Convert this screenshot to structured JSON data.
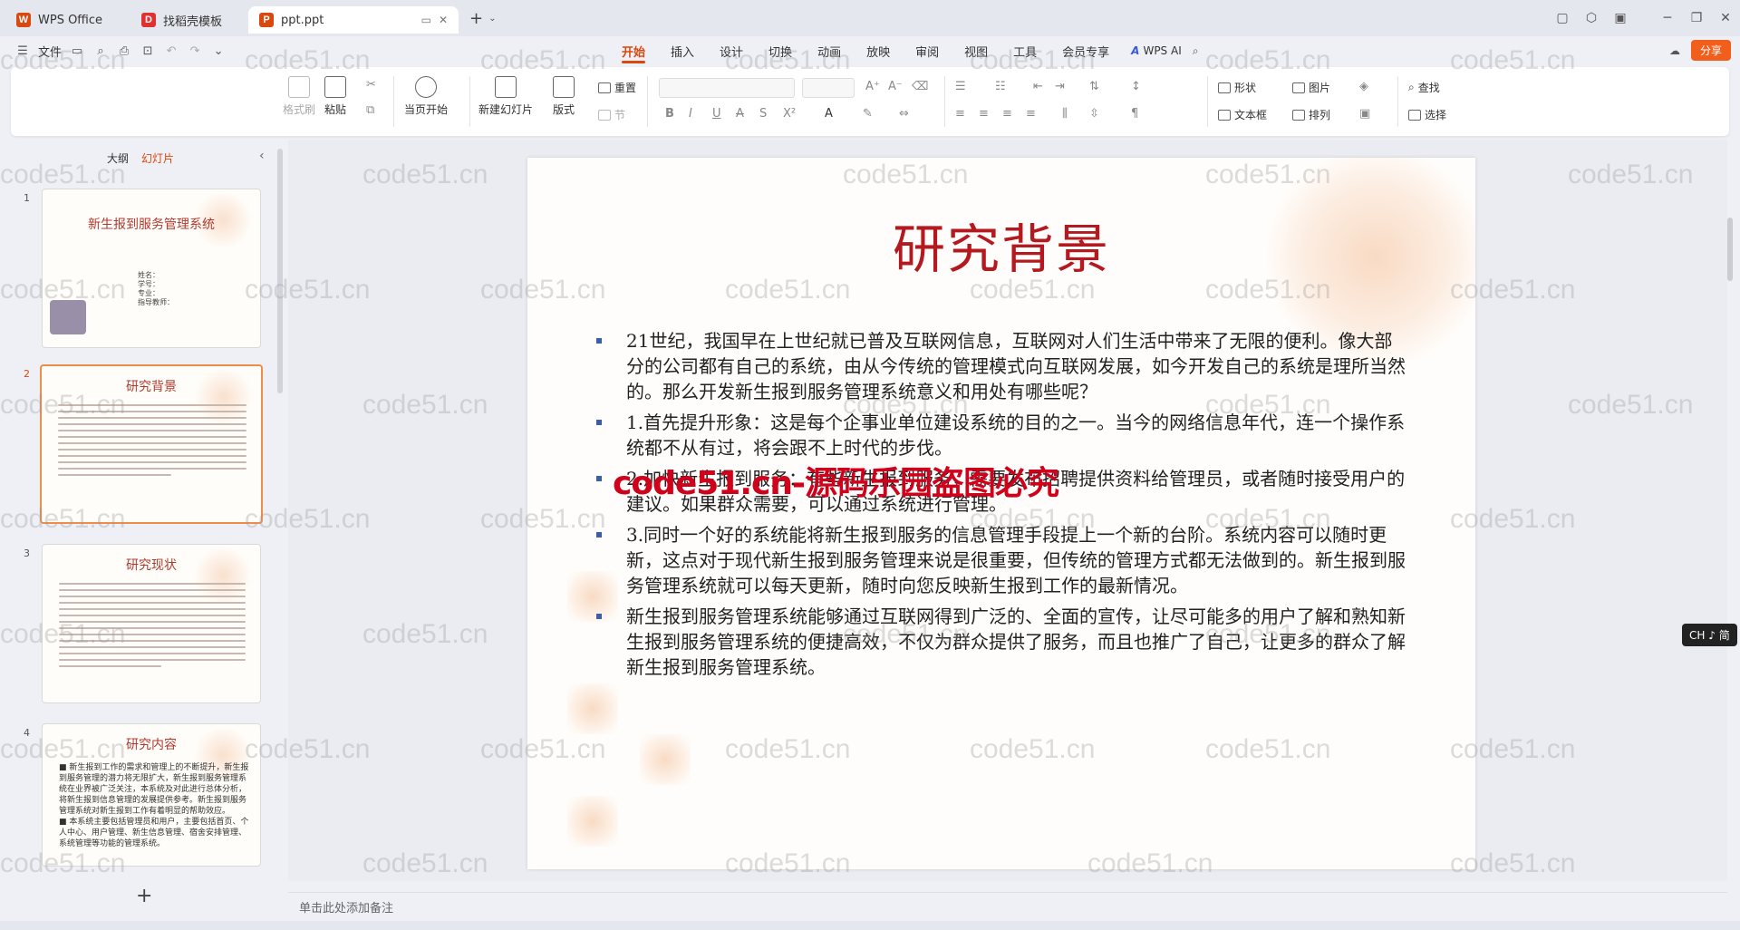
{
  "titlebar": {
    "tabs": [
      {
        "label": "WPS Office",
        "icon": "wps-logo-icon",
        "color": "#d9480f"
      },
      {
        "label": "找稻壳模板",
        "icon": "docer-icon",
        "color": "#e03131"
      },
      {
        "label": "ppt.ppt",
        "icon": "ppt-file-icon",
        "color": "#d9480f"
      }
    ],
    "new_tab": "+"
  },
  "menubar": {
    "file_label": "文件",
    "tabs": [
      "开始",
      "插入",
      "设计",
      "切换",
      "动画",
      "放映",
      "审阅",
      "视图",
      "工具",
      "会员专享"
    ],
    "active_tab": "开始",
    "ai_label": "WPS AI",
    "share_label": "分享"
  },
  "ribbon": {
    "format_painter": "格式刷",
    "paste": "粘贴",
    "play_from_current": "当页开始",
    "new_slide": "新建幻灯片",
    "layout": "版式",
    "reset": "重置",
    "section": "节",
    "shape": "形状",
    "picture": "图片",
    "textbox": "文本框",
    "arrange": "排列",
    "find": "查找",
    "select": "选择"
  },
  "left_panel": {
    "tabs": [
      "大纲",
      "幻灯片"
    ],
    "active_tab": "幻灯片",
    "slides": [
      {
        "num": "1",
        "title": "新生报到服务管理系统",
        "info": [
          "姓名：",
          "学号：",
          "专业：",
          "指导教师："
        ]
      },
      {
        "num": "2",
        "title": "研究背景"
      },
      {
        "num": "3",
        "title": "研究现状"
      },
      {
        "num": "4",
        "title": "研究内容",
        "text": "■ 新生报到工作的需求和管理上的不断提升，新生报到服务管理的潜力将无限扩大，新生报到服务管理系统在业界被广泛关注，本系统及对此进行总体分析，将新生报到信息管理的发展提供参考。新生报到服务管理系统对新生报到工作有着明显的帮助效应。\n■ 本系统主要包括管理员和用户，主要包括首页、个人中心、用户管理、新生信息管理、宿舍安排管理、系统管理等功能的管理系统。"
      }
    ],
    "add_slide": "+"
  },
  "slide": {
    "title": "研究背景",
    "bullets": [
      "21世纪，我国早在上世纪就已普及互联网信息，互联网对人们生活中带来了无限的便利。像大部分的公司都有自己的系统，由从今传统的管理模式向互联网发展，如今开发自己的系统是理所当然的。那么开发新生报到服务管理系统意义和用处有哪些呢？",
      "1.首先提升形象：这是每个企事业单位建设系统的目的之一。当今的网络信息年代，连一个操作系统都不从有过，将会跟不上时代的步伐。",
      "2.加快新生报到服务：有些新生报到服务，需要发布招聘提供资料给管理员，或者随时接受用户的建议。如果群众需要，可以通过系统进行管理。",
      "3.同时一个好的系统能将新生报到服务的信息管理手段提上一个新的台阶。系统内容可以随时更新，这点对于现代新生报到服务管理来说是很重要，但传统的管理方式都无法做到的。新生报到服务管理系统就可以每天更新，随时向您反映新生报到工作的最新情况。",
      "新生报到服务管理系统能够通过互联网得到广泛的、全面的宣传，让尽可能多的用户了解和熟知新生报到服务管理系统的便捷高效，不仅为群众提供了服务，而且也推广了自己，让更多的群众了解新生报到服务管理系统。"
    ]
  },
  "overlay": {
    "text": "code51.cn-源码乐园盗图必究",
    "color": "#d0021b"
  },
  "watermark": {
    "text": "code51.cn"
  },
  "ime_badge": "CH ♪ 简",
  "notes": {
    "placeholder": "单击此处添加备注"
  },
  "colors": {
    "accent": "#d9480f",
    "title_red": "#b3191e",
    "bullet_blue": "#3a5fa8"
  }
}
